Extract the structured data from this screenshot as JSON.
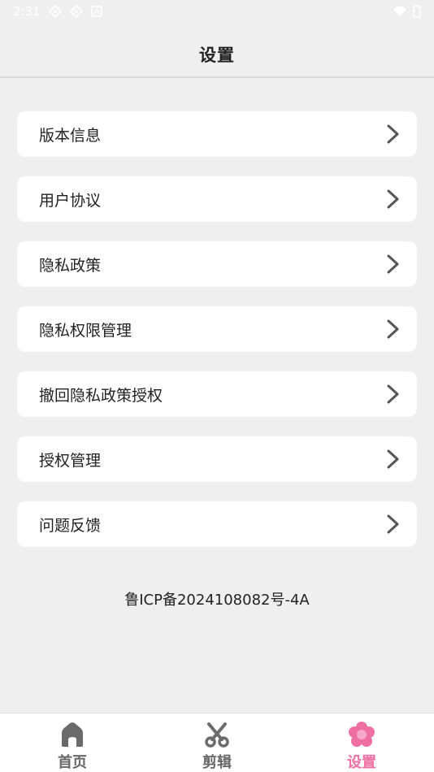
{
  "status_bar": {
    "time": "2:31"
  },
  "header": {
    "title": "设置"
  },
  "menu": {
    "items": [
      {
        "label": "版本信息"
      },
      {
        "label": "用户协议"
      },
      {
        "label": "隐私政策"
      },
      {
        "label": "隐私权限管理"
      },
      {
        "label": "撤回隐私政策授权"
      },
      {
        "label": "授权管理"
      },
      {
        "label": "问题反馈"
      }
    ],
    "chevron_icon": "chevron-right-icon"
  },
  "footer": {
    "icp": "鲁ICP备2024108082号-4A"
  },
  "tabbar": {
    "tabs": [
      {
        "label": "首页",
        "icon": "home-icon",
        "active": false
      },
      {
        "label": "剪辑",
        "icon": "scissors-icon",
        "active": false
      },
      {
        "label": "设置",
        "icon": "flower-icon",
        "active": true
      }
    ]
  },
  "colors": {
    "background": "#efeff0",
    "card": "#ffffff",
    "accent": "#f06fa3",
    "inactive_tab": "#666666"
  }
}
